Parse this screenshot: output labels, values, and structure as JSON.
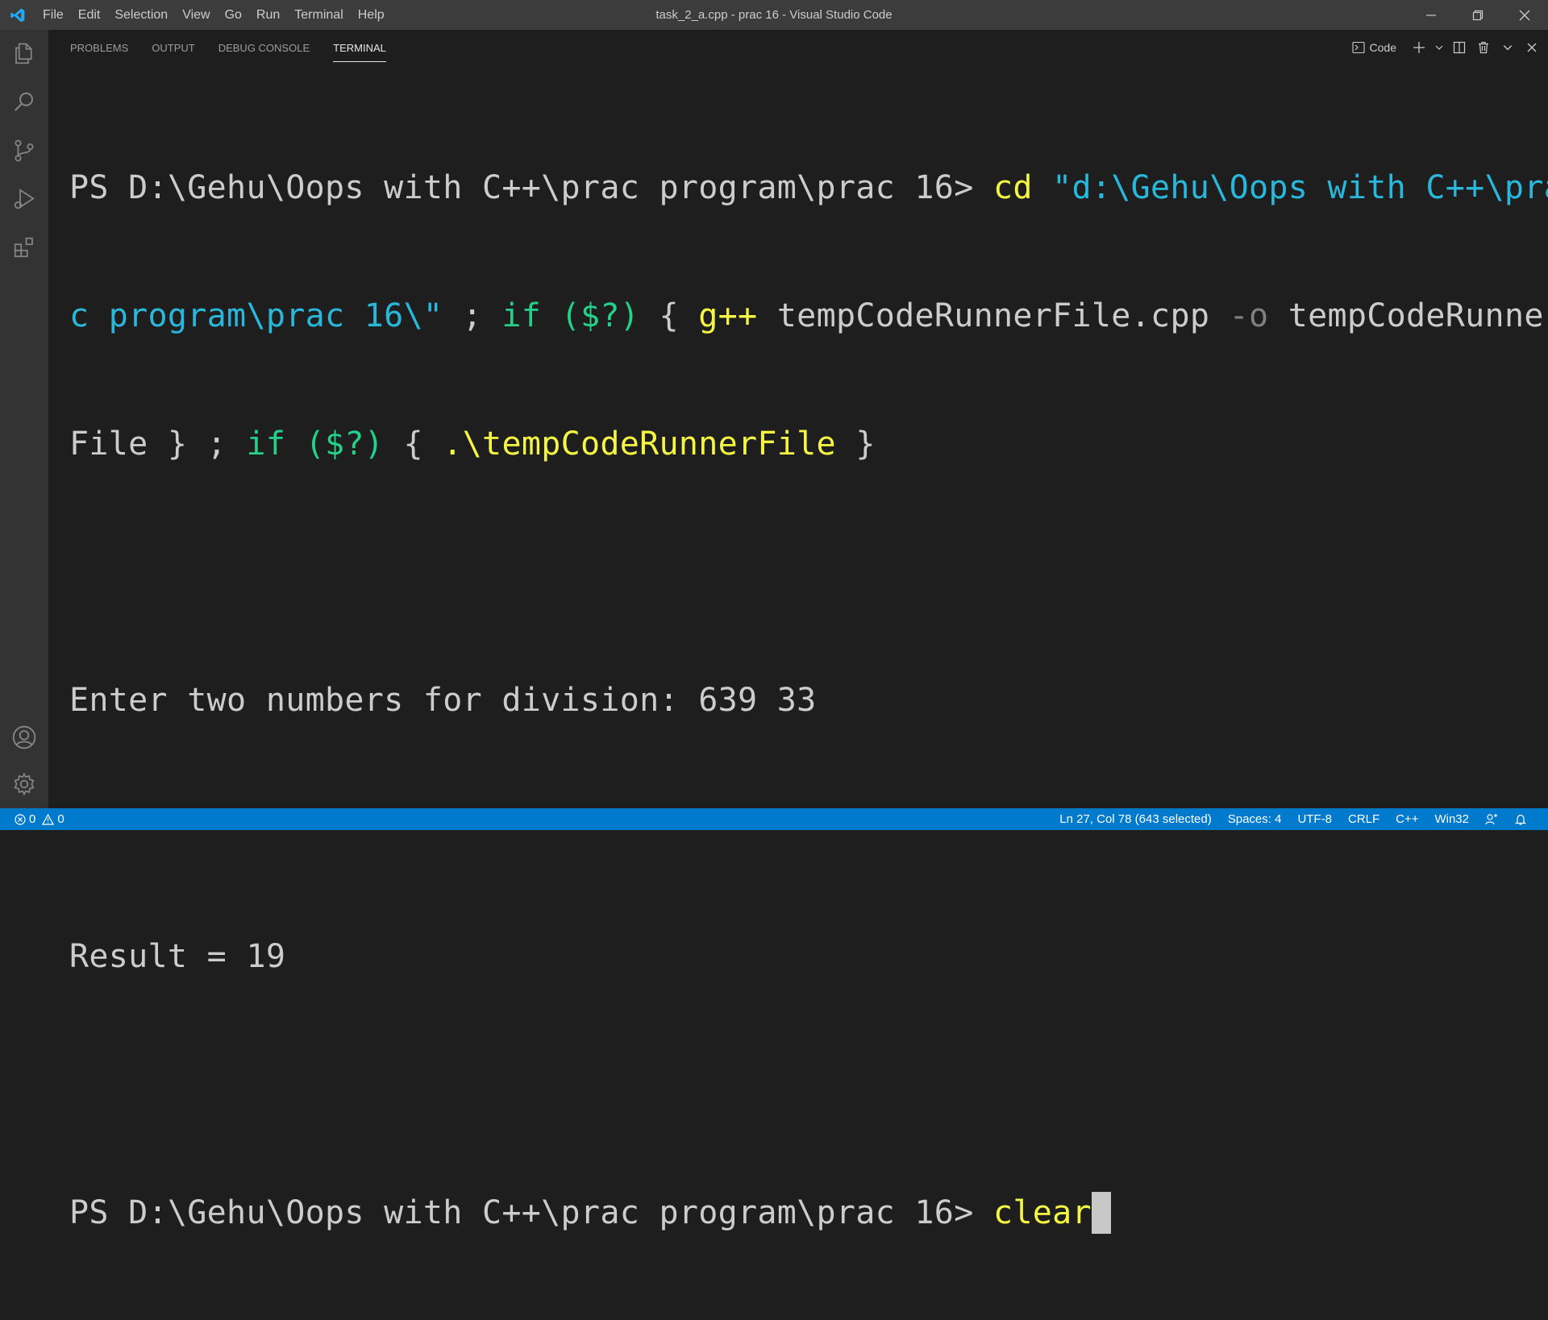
{
  "window": {
    "title": "task_2_a.cpp - prac 16 - Visual Studio Code",
    "menu": [
      "File",
      "Edit",
      "Selection",
      "View",
      "Go",
      "Run",
      "Terminal",
      "Help"
    ]
  },
  "panel": {
    "tabs": [
      "PROBLEMS",
      "OUTPUT",
      "DEBUG CONSOLE",
      "TERMINAL"
    ],
    "active_tab": "TERMINAL",
    "terminal_selector": "Code"
  },
  "terminal": {
    "prompt": "PS D:\\Gehu\\Oops with C++\\prac program\\prac 16> ",
    "cmd_cd": "cd",
    "path_part1": "\"d:\\Gehu\\Oops with C++\\pra",
    "path_part2": "c program\\prac 16\\\"",
    "semi": " ; ",
    "if_kw": "if",
    "status_var": "($?)",
    "brace_open": " { ",
    "gpp": "g++",
    "source": " tempCodeRunnerFile.cpp ",
    "flag": "-o",
    "out_part1": " tempCodeRunner",
    "out_part2": "File } ; ",
    "run_exe": ".\\tempCodeRunnerFile",
    "brace_close": " }",
    "output_line1": "Enter two numbers for division: 639 33",
    "output_line2": "Result = 19",
    "prompt2": "PS D:\\Gehu\\Oops with C++\\prac program\\prac 16> ",
    "typed_command": "clear"
  },
  "statusbar": {
    "errors": "0",
    "warnings": "0",
    "position": "Ln 27, Col 78 (643 selected)",
    "spaces": "Spaces: 4",
    "encoding": "UTF-8",
    "eol": "CRLF",
    "language": "C++",
    "platform": "Win32"
  },
  "colors": {
    "accent": "#007acc",
    "titlebar": "#3c3c3c",
    "activitybar": "#333333",
    "terminal_bg": "#1e1e1e",
    "ansi_yellow": "#f5f543",
    "ansi_cyan": "#29b8db",
    "ansi_green": "#23d18b"
  },
  "icons": [
    "vscode-logo-icon",
    "explorer-icon",
    "search-icon",
    "source-control-icon",
    "run-debug-icon",
    "extensions-icon",
    "accounts-icon",
    "manage-gear-icon"
  ]
}
